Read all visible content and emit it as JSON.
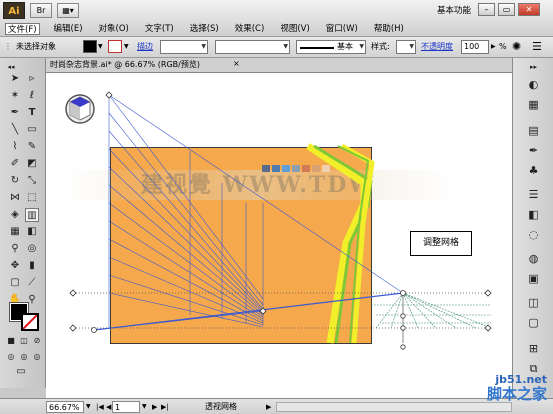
{
  "app": {
    "logo": "Ai",
    "workspace": "基本功能",
    "menus": [
      "文件(F)",
      "编辑(E)",
      "对象(O)",
      "文字(T)",
      "选择(S)",
      "效果(C)",
      "视图(V)",
      "窗口(W)",
      "帮助(H)"
    ]
  },
  "control_bar": {
    "selection_status": "未选择对象",
    "stroke_label": "描边",
    "brush_style": "基本",
    "style_label": "样式:",
    "opacity_label": "不透明度",
    "opacity_value": "100",
    "opacity_unit": "%"
  },
  "document": {
    "tab_title": "时尚杂志背景.ai* @ 66.67% (RGB/预览)",
    "close": "×"
  },
  "canvas": {
    "callout": "调整网格",
    "watermark": "建视覺 WWW.TDW"
  },
  "status_bar": {
    "zoom": "66.67%",
    "page": "1",
    "tool_status": "透视网格"
  },
  "credit": {
    "site": "jb51.net",
    "name": "脚本之家"
  },
  "colors": {
    "artboard": "#f5a84c",
    "grid_line": "#3d5bd1",
    "grid_right": "#3e8e6a",
    "road_yellow": "#f2ef2a",
    "road_green": "#7ec836"
  },
  "icons": [
    "selection-tool-icon",
    "direct-selection-icon",
    "magic-wand-icon",
    "lasso-icon",
    "pen-icon",
    "type-icon",
    "line-icon",
    "rectangle-icon",
    "paintbrush-icon",
    "pencil-icon",
    "blob-brush-icon",
    "eraser-icon",
    "rotate-icon",
    "scale-icon",
    "width-icon",
    "free-transform-icon",
    "shape-builder-icon",
    "perspective-grid-icon",
    "mesh-icon",
    "gradient-icon",
    "eyedropper-icon",
    "blend-icon",
    "symbol-sprayer-icon",
    "column-graph-icon",
    "artboard-icon",
    "slice-icon",
    "hand-icon",
    "zoom-icon"
  ]
}
